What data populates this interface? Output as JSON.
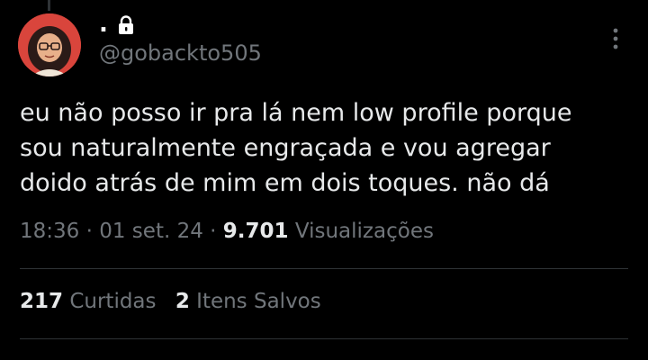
{
  "author": {
    "display_name": ".",
    "handle": "@gobackto505",
    "avatar_icon": "avatar-illustration",
    "protected_icon": "lock-icon"
  },
  "tweet": {
    "text_lines": [
      "eu não posso ir pra lá nem low profile porque",
      "sou naturalmente engraçada e vou agregar",
      "doido atrás de mim em dois toques. não dá"
    ],
    "time": "18:36",
    "separator": "·",
    "date": "01 set. 24",
    "views_count": "9.701",
    "views_label": "Visualizações"
  },
  "stats": {
    "likes_count": "217",
    "likes_label": "Curtidas",
    "saves_count": "2",
    "saves_label": "Itens Salvos"
  },
  "colors": {
    "background": "#000000",
    "text_primary": "#e7e9ea",
    "text_secondary": "#71767b",
    "divider": "#2f3336"
  }
}
